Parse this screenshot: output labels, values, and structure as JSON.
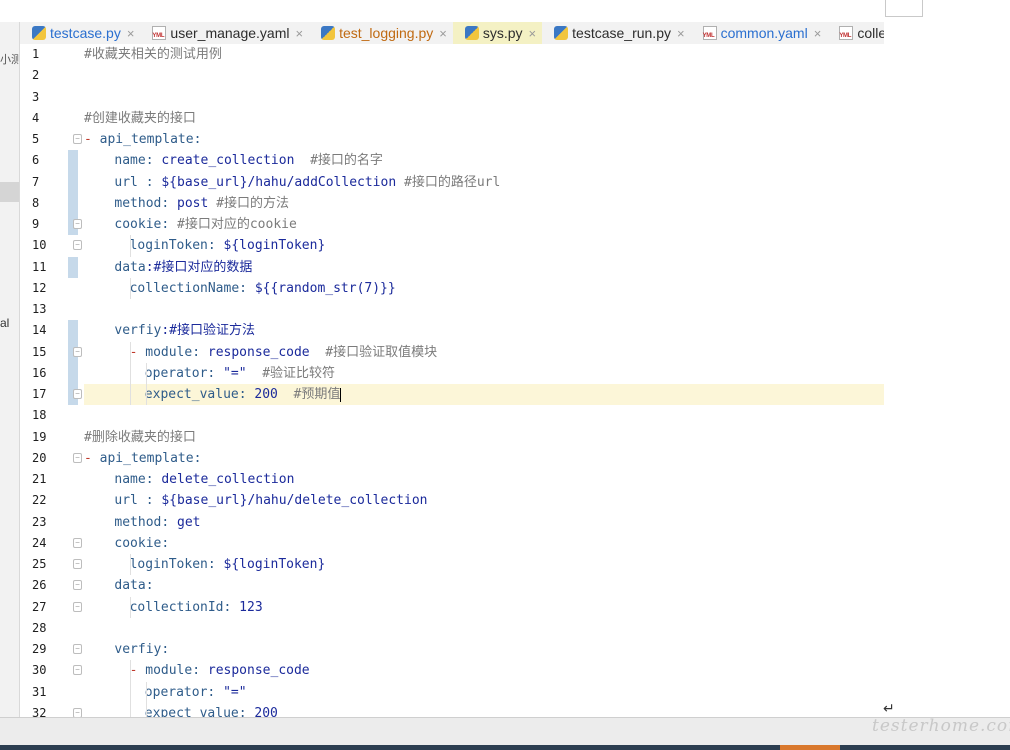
{
  "left_panel": {
    "text1": "小测",
    "text2": "al"
  },
  "tabs": [
    {
      "label": "testcase.py",
      "icon": "python-file-icon",
      "color": "blue"
    },
    {
      "label": "user_manage.yaml",
      "icon": "yaml-file-icon",
      "color": ""
    },
    {
      "label": "test_logging.py",
      "icon": "python-file-icon",
      "color": "orange"
    },
    {
      "label": "sys.py",
      "icon": "python-file-icon",
      "color": "",
      "active": true
    },
    {
      "label": "testcase_run.py",
      "icon": "python-file-icon",
      "color": ""
    },
    {
      "label": "common.yaml",
      "icon": "yaml-file-icon",
      "color": "blue"
    },
    {
      "label": "colle",
      "icon": "yaml-file-icon",
      "color": ""
    }
  ],
  "tab_close_glyph": "×",
  "lines": [
    {
      "n": "1",
      "indent": 0,
      "segs": [
        [
          "cm",
          "#收藏夹相关的测试用例"
        ]
      ]
    },
    {
      "n": "2",
      "indent": 0,
      "segs": []
    },
    {
      "n": "3",
      "indent": 0,
      "segs": []
    },
    {
      "n": "4",
      "indent": 0,
      "segs": [
        [
          "cm",
          "#创建收藏夹的接口"
        ]
      ]
    },
    {
      "n": "5",
      "indent": 0,
      "fold": true,
      "segs": [
        [
          "dash",
          "- "
        ],
        [
          "key",
          "api_template"
        ],
        [
          "key",
          ":"
        ]
      ]
    },
    {
      "n": "6",
      "indent": 4,
      "changed": true,
      "segs": [
        [
          "key",
          "name"
        ],
        [
          "key",
          ": "
        ],
        [
          "val",
          "create_collection"
        ],
        [
          "cm",
          "  #接口的名字"
        ]
      ]
    },
    {
      "n": "7",
      "indent": 4,
      "changed": true,
      "segs": [
        [
          "key",
          "url"
        ],
        [
          "key",
          " : "
        ],
        [
          "val",
          "${base_url}/hahu/addCollection"
        ],
        [
          "cm",
          " #接口的路径url"
        ]
      ]
    },
    {
      "n": "8",
      "indent": 4,
      "changed": true,
      "segs": [
        [
          "key",
          "method"
        ],
        [
          "key",
          ": "
        ],
        [
          "val",
          "post"
        ],
        [
          "cm",
          " #接口的方法"
        ]
      ]
    },
    {
      "n": "9",
      "indent": 4,
      "changed": true,
      "fold": true,
      "segs": [
        [
          "key",
          "cookie"
        ],
        [
          "key",
          ": "
        ],
        [
          "cm",
          "#接口对应的cookie"
        ]
      ]
    },
    {
      "n": "10",
      "indent": 6,
      "fold": true,
      "segs": [
        [
          "key",
          "loginToken"
        ],
        [
          "key",
          ": "
        ],
        [
          "val",
          "${loginToken}"
        ]
      ]
    },
    {
      "n": "11",
      "indent": 4,
      "changed": true,
      "segs": [
        [
          "key",
          "data"
        ],
        [
          "val",
          ":#接口对应的数据"
        ]
      ]
    },
    {
      "n": "12",
      "indent": 6,
      "segs": [
        [
          "key",
          "collectionName"
        ],
        [
          "key",
          ": "
        ],
        [
          "val",
          "${{random_str(7)}}"
        ]
      ]
    },
    {
      "n": "13",
      "indent": 0,
      "segs": []
    },
    {
      "n": "14",
      "indent": 4,
      "changed": true,
      "segs": [
        [
          "key",
          "verfiy"
        ],
        [
          "val",
          ":#接口验证方法"
        ]
      ]
    },
    {
      "n": "15",
      "indent": 6,
      "changed": true,
      "fold": true,
      "segs": [
        [
          "dash",
          "- "
        ],
        [
          "key",
          "module"
        ],
        [
          "key",
          ": "
        ],
        [
          "val",
          "response_code"
        ],
        [
          "cm",
          "  #接口验证取值模块"
        ]
      ]
    },
    {
      "n": "16",
      "indent": 8,
      "changed": true,
      "segs": [
        [
          "key",
          "operator"
        ],
        [
          "key",
          ": "
        ],
        [
          "val",
          "\"=\""
        ],
        [
          "cm",
          "  #验证比较符"
        ]
      ]
    },
    {
      "n": "17",
      "indent": 8,
      "changed": true,
      "fold": true,
      "current": true,
      "caret": true,
      "segs": [
        [
          "key",
          "expect_value"
        ],
        [
          "key",
          ": "
        ],
        [
          "val",
          "200"
        ],
        [
          "cm",
          "  #预期值"
        ]
      ]
    },
    {
      "n": "18",
      "indent": 0,
      "segs": []
    },
    {
      "n": "19",
      "indent": 0,
      "segs": [
        [
          "cm",
          "#删除收藏夹的接口"
        ]
      ]
    },
    {
      "n": "20",
      "indent": 0,
      "fold": true,
      "segs": [
        [
          "dash",
          "- "
        ],
        [
          "key",
          "api_template"
        ],
        [
          "key",
          ":"
        ]
      ]
    },
    {
      "n": "21",
      "indent": 4,
      "segs": [
        [
          "key",
          "name"
        ],
        [
          "key",
          ": "
        ],
        [
          "val",
          "delete_collection"
        ]
      ]
    },
    {
      "n": "22",
      "indent": 4,
      "segs": [
        [
          "key",
          "url"
        ],
        [
          "key",
          " : "
        ],
        [
          "val",
          "${base_url}/hahu/delete_collection"
        ]
      ]
    },
    {
      "n": "23",
      "indent": 4,
      "segs": [
        [
          "key",
          "method"
        ],
        [
          "key",
          ": "
        ],
        [
          "val",
          "get"
        ]
      ]
    },
    {
      "n": "24",
      "indent": 4,
      "fold": true,
      "segs": [
        [
          "key",
          "cookie"
        ],
        [
          "key",
          ":"
        ]
      ]
    },
    {
      "n": "25",
      "indent": 6,
      "fold": true,
      "segs": [
        [
          "key",
          "loginToken"
        ],
        [
          "key",
          ": "
        ],
        [
          "val",
          "${loginToken}"
        ]
      ]
    },
    {
      "n": "26",
      "indent": 4,
      "fold": true,
      "segs": [
        [
          "key",
          "data"
        ],
        [
          "key",
          ":"
        ]
      ]
    },
    {
      "n": "27",
      "indent": 6,
      "fold": true,
      "segs": [
        [
          "key",
          "collectionId"
        ],
        [
          "key",
          ": "
        ],
        [
          "val",
          "123"
        ]
      ]
    },
    {
      "n": "28",
      "indent": 0,
      "segs": []
    },
    {
      "n": "29",
      "indent": 4,
      "fold": true,
      "segs": [
        [
          "key",
          "verfiy"
        ],
        [
          "key",
          ":"
        ]
      ]
    },
    {
      "n": "30",
      "indent": 6,
      "fold": true,
      "segs": [
        [
          "dash",
          "- "
        ],
        [
          "key",
          "module"
        ],
        [
          "key",
          ": "
        ],
        [
          "val",
          "response_code"
        ]
      ]
    },
    {
      "n": "31",
      "indent": 8,
      "segs": [
        [
          "key",
          "operator"
        ],
        [
          "key",
          ": "
        ],
        [
          "val",
          "\"=\""
        ]
      ]
    },
    {
      "n": "32",
      "indent": 8,
      "fold": true,
      "segs": [
        [
          "key",
          "expect_value"
        ],
        [
          "key",
          ": "
        ],
        [
          "val",
          "200"
        ]
      ]
    }
  ],
  "enter_glyph": "↵",
  "watermark": "testerhome.com",
  "colors": {
    "accent_change": "#c6d9ea",
    "current_line": "#fcf6d8",
    "active_tab": "#f4f1c4"
  }
}
